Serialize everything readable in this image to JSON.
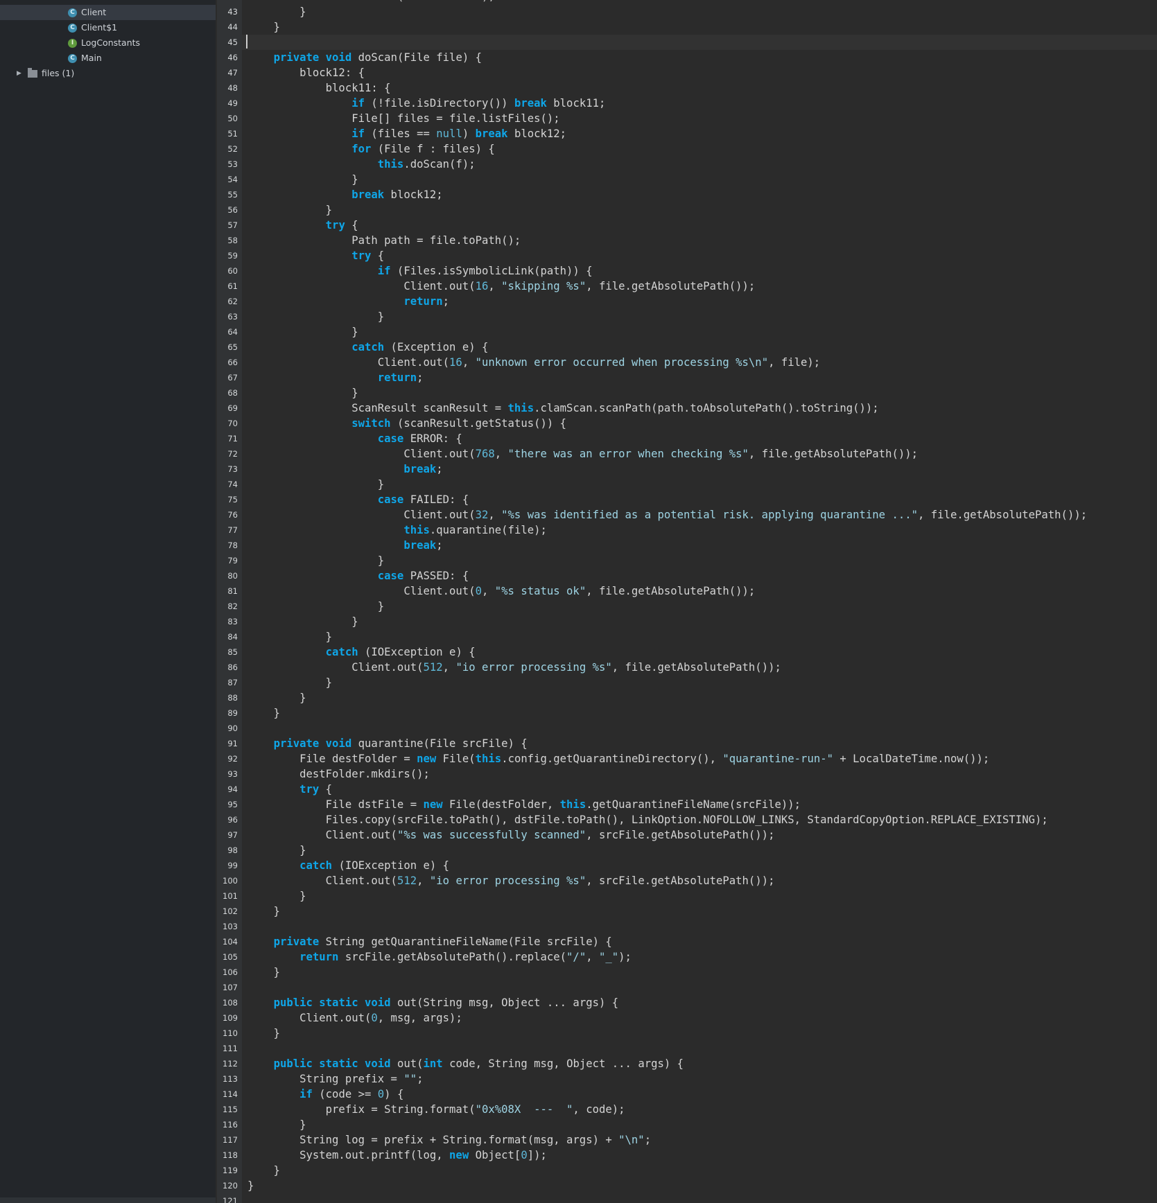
{
  "project_tree": {
    "items": [
      {
        "label": "Client",
        "kind": "class",
        "icon": "class-icon",
        "selected": true
      },
      {
        "label": "Client$1",
        "kind": "class",
        "icon": "class-icon",
        "selected": false
      },
      {
        "label": "LogConstants",
        "kind": "interface",
        "icon": "interface-icon",
        "selected": false
      },
      {
        "label": "Main",
        "kind": "class",
        "icon": "class-icon",
        "selected": false
      },
      {
        "label": "files (1)",
        "kind": "folder",
        "icon": "folder-icon",
        "selected": false,
        "expanded": false
      }
    ]
  },
  "editor": {
    "language": "java",
    "first_line": 42,
    "caret_line": 45,
    "colors": {
      "keyword": "#0fa6e8",
      "number": "#5fb8d8",
      "string": "#9ed4e4",
      "text": "#d4d4d4",
      "background": "#2b2b2b",
      "gutter": "#313335",
      "sidebar": "#23262a"
    },
    "lines": [
      [
        [
          "            ",
          "t"
        ],
        [
          "this",
          "k"
        ],
        [
          ".doScan(documentRoot);",
          "t"
        ]
      ],
      [
        [
          "        }",
          "t"
        ]
      ],
      [
        [
          "    }",
          "t"
        ]
      ],
      [
        [
          "",
          "t"
        ]
      ],
      [
        [
          "    ",
          "t"
        ],
        [
          "private void",
          "k"
        ],
        [
          " doScan(File file) {",
          "t"
        ]
      ],
      [
        [
          "        block12: {",
          "t"
        ]
      ],
      [
        [
          "            block11: {",
          "t"
        ]
      ],
      [
        [
          "                ",
          "t"
        ],
        [
          "if",
          "k"
        ],
        [
          " (!file.isDirectory()) ",
          "t"
        ],
        [
          "break",
          "k"
        ],
        [
          " block11;",
          "t"
        ]
      ],
      [
        [
          "                File[] files = file.listFiles();",
          "t"
        ]
      ],
      [
        [
          "                ",
          "t"
        ],
        [
          "if",
          "k"
        ],
        [
          " (files == ",
          "t"
        ],
        [
          "null",
          "n"
        ],
        [
          ") ",
          "t"
        ],
        [
          "break",
          "k"
        ],
        [
          " block12;",
          "t"
        ]
      ],
      [
        [
          "                ",
          "t"
        ],
        [
          "for",
          "k"
        ],
        [
          " (File f : files) {",
          "t"
        ]
      ],
      [
        [
          "                    ",
          "t"
        ],
        [
          "this",
          "k"
        ],
        [
          ".doScan(f);",
          "t"
        ]
      ],
      [
        [
          "                }",
          "t"
        ]
      ],
      [
        [
          "                ",
          "t"
        ],
        [
          "break",
          "k"
        ],
        [
          " block12;",
          "t"
        ]
      ],
      [
        [
          "            }",
          "t"
        ]
      ],
      [
        [
          "            ",
          "t"
        ],
        [
          "try",
          "k"
        ],
        [
          " {",
          "t"
        ]
      ],
      [
        [
          "                Path path = file.toPath();",
          "t"
        ]
      ],
      [
        [
          "                ",
          "t"
        ],
        [
          "try",
          "k"
        ],
        [
          " {",
          "t"
        ]
      ],
      [
        [
          "                    ",
          "t"
        ],
        [
          "if",
          "k"
        ],
        [
          " (Files.isSymbolicLink(path)) {",
          "t"
        ]
      ],
      [
        [
          "                        Client.out(",
          "t"
        ],
        [
          "16",
          "n"
        ],
        [
          ", ",
          "t"
        ],
        [
          "\"skipping %s\"",
          "s"
        ],
        [
          ", file.getAbsolutePath());",
          "t"
        ]
      ],
      [
        [
          "                        ",
          "t"
        ],
        [
          "return",
          "k"
        ],
        [
          ";",
          "t"
        ]
      ],
      [
        [
          "                    }",
          "t"
        ]
      ],
      [
        [
          "                }",
          "t"
        ]
      ],
      [
        [
          "                ",
          "t"
        ],
        [
          "catch",
          "k"
        ],
        [
          " (Exception e) {",
          "t"
        ]
      ],
      [
        [
          "                    Client.out(",
          "t"
        ],
        [
          "16",
          "n"
        ],
        [
          ", ",
          "t"
        ],
        [
          "\"unknown error occurred when processing %s\\n\"",
          "s"
        ],
        [
          ", file);",
          "t"
        ]
      ],
      [
        [
          "                    ",
          "t"
        ],
        [
          "return",
          "k"
        ],
        [
          ";",
          "t"
        ]
      ],
      [
        [
          "                }",
          "t"
        ]
      ],
      [
        [
          "                ScanResult scanResult = ",
          "t"
        ],
        [
          "this",
          "k"
        ],
        [
          ".clamScan.scanPath(path.toAbsolutePath().toString());",
          "t"
        ]
      ],
      [
        [
          "                ",
          "t"
        ],
        [
          "switch",
          "k"
        ],
        [
          " (scanResult.getStatus()) {",
          "t"
        ]
      ],
      [
        [
          "                    ",
          "t"
        ],
        [
          "case",
          "k"
        ],
        [
          " ERROR: {",
          "t"
        ]
      ],
      [
        [
          "                        Client.out(",
          "t"
        ],
        [
          "768",
          "n"
        ],
        [
          ", ",
          "t"
        ],
        [
          "\"there was an error when checking %s\"",
          "s"
        ],
        [
          ", file.getAbsolutePath());",
          "t"
        ]
      ],
      [
        [
          "                        ",
          "t"
        ],
        [
          "break",
          "k"
        ],
        [
          ";",
          "t"
        ]
      ],
      [
        [
          "                    }",
          "t"
        ]
      ],
      [
        [
          "                    ",
          "t"
        ],
        [
          "case",
          "k"
        ],
        [
          " FAILED: {",
          "t"
        ]
      ],
      [
        [
          "                        Client.out(",
          "t"
        ],
        [
          "32",
          "n"
        ],
        [
          ", ",
          "t"
        ],
        [
          "\"%s was identified as a potential risk. applying quarantine ...\"",
          "s"
        ],
        [
          ", file.getAbsolutePath());",
          "t"
        ]
      ],
      [
        [
          "                        ",
          "t"
        ],
        [
          "this",
          "k"
        ],
        [
          ".quarantine(file);",
          "t"
        ]
      ],
      [
        [
          "                        ",
          "t"
        ],
        [
          "break",
          "k"
        ],
        [
          ";",
          "t"
        ]
      ],
      [
        [
          "                    }",
          "t"
        ]
      ],
      [
        [
          "                    ",
          "t"
        ],
        [
          "case",
          "k"
        ],
        [
          " PASSED: {",
          "t"
        ]
      ],
      [
        [
          "                        Client.out(",
          "t"
        ],
        [
          "0",
          "n"
        ],
        [
          ", ",
          "t"
        ],
        [
          "\"%s status ok\"",
          "s"
        ],
        [
          ", file.getAbsolutePath());",
          "t"
        ]
      ],
      [
        [
          "                    }",
          "t"
        ]
      ],
      [
        [
          "                }",
          "t"
        ]
      ],
      [
        [
          "            }",
          "t"
        ]
      ],
      [
        [
          "            ",
          "t"
        ],
        [
          "catch",
          "k"
        ],
        [
          " (IOException e) {",
          "t"
        ]
      ],
      [
        [
          "                Client.out(",
          "t"
        ],
        [
          "512",
          "n"
        ],
        [
          ", ",
          "t"
        ],
        [
          "\"io error processing %s\"",
          "s"
        ],
        [
          ", file.getAbsolutePath());",
          "t"
        ]
      ],
      [
        [
          "            }",
          "t"
        ]
      ],
      [
        [
          "        }",
          "t"
        ]
      ],
      [
        [
          "    }",
          "t"
        ]
      ],
      [
        [
          "",
          "t"
        ]
      ],
      [
        [
          "    ",
          "t"
        ],
        [
          "private void",
          "k"
        ],
        [
          " quarantine(File srcFile) {",
          "t"
        ]
      ],
      [
        [
          "        File destFolder = ",
          "t"
        ],
        [
          "new",
          "k"
        ],
        [
          " File(",
          "t"
        ],
        [
          "this",
          "k"
        ],
        [
          ".config.getQuarantineDirectory(), ",
          "t"
        ],
        [
          "\"quarantine-run-\"",
          "s"
        ],
        [
          " + LocalDateTime.now());",
          "t"
        ]
      ],
      [
        [
          "        destFolder.mkdirs();",
          "t"
        ]
      ],
      [
        [
          "        ",
          "t"
        ],
        [
          "try",
          "k"
        ],
        [
          " {",
          "t"
        ]
      ],
      [
        [
          "            File dstFile = ",
          "t"
        ],
        [
          "new",
          "k"
        ],
        [
          " File(destFolder, ",
          "t"
        ],
        [
          "this",
          "k"
        ],
        [
          ".getQuarantineFileName(srcFile));",
          "t"
        ]
      ],
      [
        [
          "            Files.copy(srcFile.toPath(), dstFile.toPath(), LinkOption.NOFOLLOW_LINKS, StandardCopyOption.REPLACE_EXISTING);",
          "t"
        ]
      ],
      [
        [
          "            Client.out(",
          "t"
        ],
        [
          "\"%s was successfully scanned\"",
          "s"
        ],
        [
          ", srcFile.getAbsolutePath());",
          "t"
        ]
      ],
      [
        [
          "        }",
          "t"
        ]
      ],
      [
        [
          "        ",
          "t"
        ],
        [
          "catch",
          "k"
        ],
        [
          " (IOException e) {",
          "t"
        ]
      ],
      [
        [
          "            Client.out(",
          "t"
        ],
        [
          "512",
          "n"
        ],
        [
          ", ",
          "t"
        ],
        [
          "\"io error processing %s\"",
          "s"
        ],
        [
          ", srcFile.getAbsolutePath());",
          "t"
        ]
      ],
      [
        [
          "        }",
          "t"
        ]
      ],
      [
        [
          "    }",
          "t"
        ]
      ],
      [
        [
          "",
          "t"
        ]
      ],
      [
        [
          "    ",
          "t"
        ],
        [
          "private",
          "k"
        ],
        [
          " String getQuarantineFileName(File srcFile) {",
          "t"
        ]
      ],
      [
        [
          "        ",
          "t"
        ],
        [
          "return",
          "k"
        ],
        [
          " srcFile.getAbsolutePath().replace(",
          "t"
        ],
        [
          "\"/\"",
          "s"
        ],
        [
          ", ",
          "t"
        ],
        [
          "\"_\"",
          "s"
        ],
        [
          ");",
          "t"
        ]
      ],
      [
        [
          "    }",
          "t"
        ]
      ],
      [
        [
          "",
          "t"
        ]
      ],
      [
        [
          "    ",
          "t"
        ],
        [
          "public static void",
          "k"
        ],
        [
          " out(String msg, Object ... args) {",
          "t"
        ]
      ],
      [
        [
          "        Client.out(",
          "t"
        ],
        [
          "0",
          "n"
        ],
        [
          ", msg, args);",
          "t"
        ]
      ],
      [
        [
          "    }",
          "t"
        ]
      ],
      [
        [
          "",
          "t"
        ]
      ],
      [
        [
          "    ",
          "t"
        ],
        [
          "public static void",
          "k"
        ],
        [
          " out(",
          "t"
        ],
        [
          "int",
          "k"
        ],
        [
          " code, String msg, Object ... args) {",
          "t"
        ]
      ],
      [
        [
          "        String prefix = ",
          "t"
        ],
        [
          "\"\"",
          "s"
        ],
        [
          ";",
          "t"
        ]
      ],
      [
        [
          "        ",
          "t"
        ],
        [
          "if",
          "k"
        ],
        [
          " (code >= ",
          "t"
        ],
        [
          "0",
          "n"
        ],
        [
          ") {",
          "t"
        ]
      ],
      [
        [
          "            prefix = String.format(",
          "t"
        ],
        [
          "\"0x%08X  ---  \"",
          "s"
        ],
        [
          ", code);",
          "t"
        ]
      ],
      [
        [
          "        }",
          "t"
        ]
      ],
      [
        [
          "        String log = prefix + String.format(msg, args) + ",
          "t"
        ],
        [
          "\"\\n\"",
          "s"
        ],
        [
          ";",
          "t"
        ]
      ],
      [
        [
          "        System.out.printf(log, ",
          "t"
        ],
        [
          "new",
          "k"
        ],
        [
          " Object[",
          "t"
        ],
        [
          "0",
          "n"
        ],
        [
          "]);",
          "t"
        ]
      ],
      [
        [
          "    }",
          "t"
        ]
      ],
      [
        [
          "}",
          "t"
        ]
      ],
      [
        [
          "",
          "t"
        ]
      ]
    ]
  }
}
